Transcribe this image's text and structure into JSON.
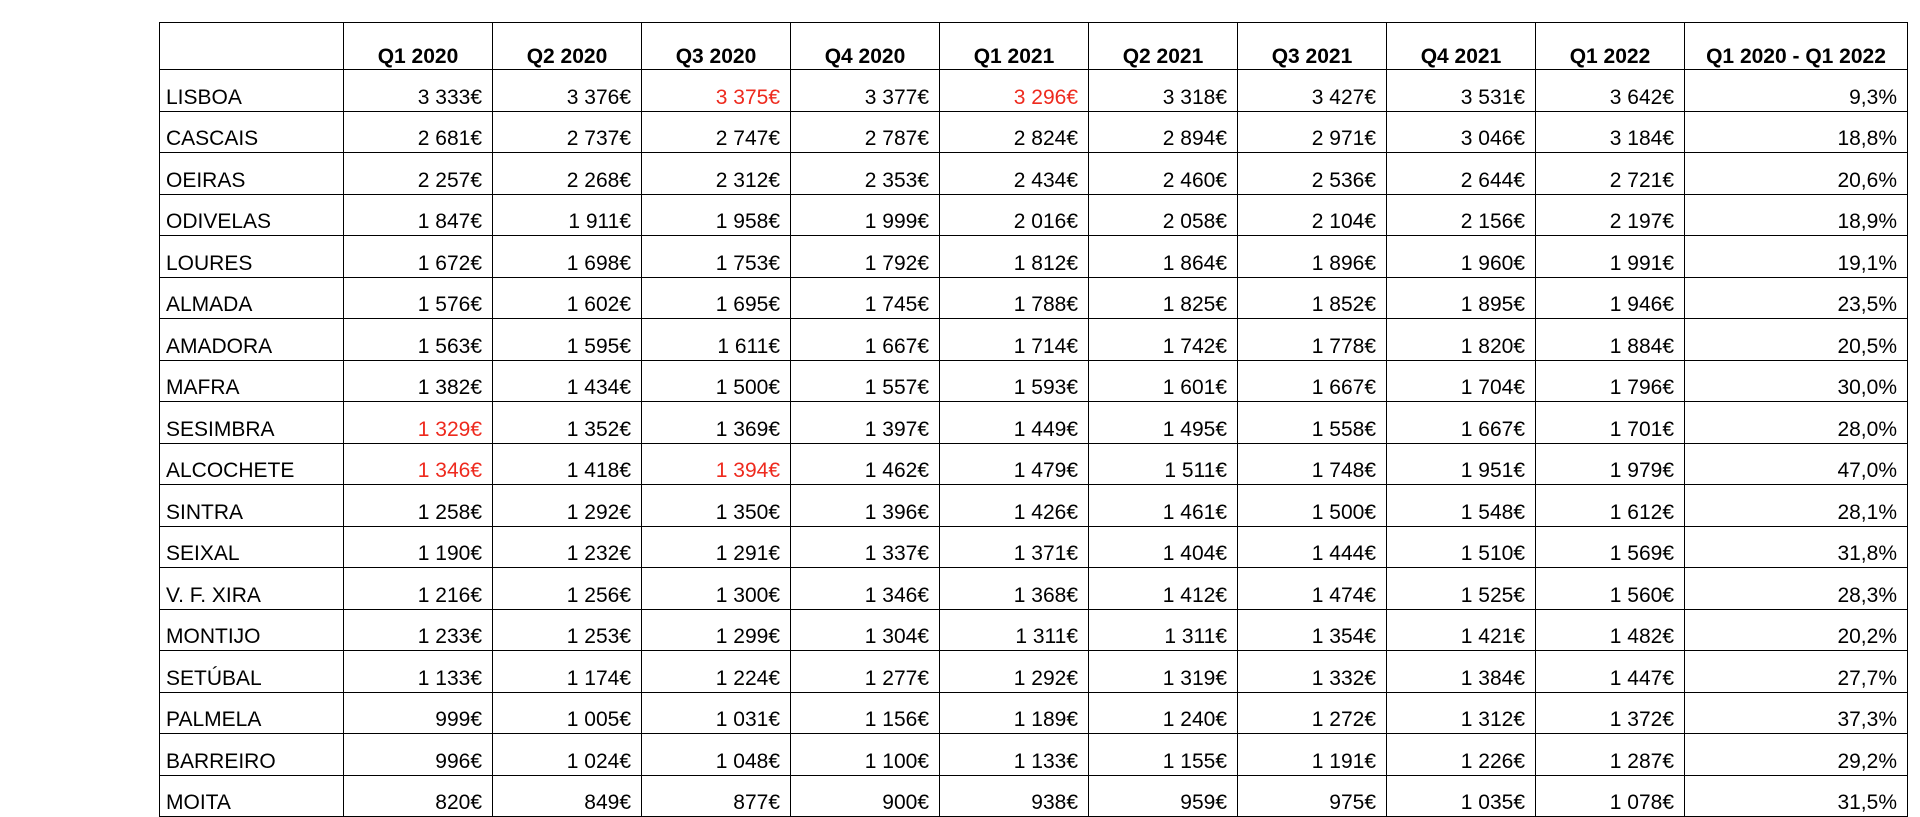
{
  "header": [
    "",
    "Q1 2020",
    "Q2 2020",
    "Q3 2020",
    "Q4 2020",
    "Q1 2021",
    "Q2 2021",
    "Q3 2021",
    "Q4 2021",
    "Q1 2022",
    "Q1 2020 - Q1 2022"
  ],
  "rows": [
    {
      "name": "LISBOA",
      "values": [
        "3 333€",
        "3 376€",
        "3 375€",
        "3 377€",
        "3 296€",
        "3 318€",
        "3 427€",
        "3 531€",
        "3 642€"
      ],
      "change": "9,3%",
      "red": [
        false,
        false,
        true,
        false,
        true,
        false,
        false,
        false,
        false
      ]
    },
    {
      "name": "CASCAIS",
      "values": [
        "2 681€",
        "2 737€",
        "2 747€",
        "2 787€",
        "2 824€",
        "2 894€",
        "2 971€",
        "3 046€",
        "3 184€"
      ],
      "change": "18,8%",
      "red": [
        false,
        false,
        false,
        false,
        false,
        false,
        false,
        false,
        false
      ]
    },
    {
      "name": "OEIRAS",
      "values": [
        "2 257€",
        "2 268€",
        "2 312€",
        "2 353€",
        "2 434€",
        "2 460€",
        "2 536€",
        "2 644€",
        "2 721€"
      ],
      "change": "20,6%",
      "red": [
        false,
        false,
        false,
        false,
        false,
        false,
        false,
        false,
        false
      ]
    },
    {
      "name": "ODIVELAS",
      "values": [
        "1 847€",
        "1 911€",
        "1 958€",
        "1 999€",
        "2 016€",
        "2 058€",
        "2 104€",
        "2 156€",
        "2 197€"
      ],
      "change": "18,9%",
      "red": [
        false,
        false,
        false,
        false,
        false,
        false,
        false,
        false,
        false
      ]
    },
    {
      "name": "LOURES",
      "values": [
        "1 672€",
        "1 698€",
        "1 753€",
        "1 792€",
        "1 812€",
        "1 864€",
        "1 896€",
        "1 960€",
        "1 991€"
      ],
      "change": "19,1%",
      "red": [
        false,
        false,
        false,
        false,
        false,
        false,
        false,
        false,
        false
      ]
    },
    {
      "name": "ALMADA",
      "values": [
        "1 576€",
        "1 602€",
        "1 695€",
        "1 745€",
        "1 788€",
        "1 825€",
        "1 852€",
        "1 895€",
        "1 946€"
      ],
      "change": "23,5%",
      "red": [
        false,
        false,
        false,
        false,
        false,
        false,
        false,
        false,
        false
      ]
    },
    {
      "name": "AMADORA",
      "values": [
        "1 563€",
        "1 595€",
        "1 611€",
        "1 667€",
        "1 714€",
        "1 742€",
        "1 778€",
        "1 820€",
        "1 884€"
      ],
      "change": "20,5%",
      "red": [
        false,
        false,
        false,
        false,
        false,
        false,
        false,
        false,
        false
      ]
    },
    {
      "name": "MAFRA",
      "values": [
        "1 382€",
        "1 434€",
        "1 500€",
        "1 557€",
        "1 593€",
        "1 601€",
        "1 667€",
        "1 704€",
        "1 796€"
      ],
      "change": "30,0%",
      "red": [
        false,
        false,
        false,
        false,
        false,
        false,
        false,
        false,
        false
      ]
    },
    {
      "name": "SESIMBRA",
      "values": [
        "1 329€",
        "1 352€",
        "1 369€",
        "1 397€",
        "1 449€",
        "1 495€",
        "1 558€",
        "1 667€",
        "1 701€"
      ],
      "change": "28,0%",
      "red": [
        true,
        false,
        false,
        false,
        false,
        false,
        false,
        false,
        false
      ]
    },
    {
      "name": "ALCOCHETE",
      "values": [
        "1 346€",
        "1 418€",
        "1 394€",
        "1 462€",
        "1 479€",
        "1 511€",
        "1 748€",
        "1 951€",
        "1 979€"
      ],
      "change": "47,0%",
      "red": [
        true,
        false,
        true,
        false,
        false,
        false,
        false,
        false,
        false
      ]
    },
    {
      "name": "SINTRA",
      "values": [
        "1 258€",
        "1 292€",
        "1 350€",
        "1 396€",
        "1 426€",
        "1 461€",
        "1 500€",
        "1 548€",
        "1 612€"
      ],
      "change": "28,1%",
      "red": [
        false,
        false,
        false,
        false,
        false,
        false,
        false,
        false,
        false
      ]
    },
    {
      "name": "SEIXAL",
      "values": [
        "1 190€",
        "1 232€",
        "1 291€",
        "1 337€",
        "1 371€",
        "1 404€",
        "1 444€",
        "1 510€",
        "1 569€"
      ],
      "change": "31,8%",
      "red": [
        false,
        false,
        false,
        false,
        false,
        false,
        false,
        false,
        false
      ]
    },
    {
      "name": "V. F. XIRA",
      "values": [
        "1 216€",
        "1 256€",
        "1 300€",
        "1 346€",
        "1 368€",
        "1 412€",
        "1 474€",
        "1 525€",
        "1 560€"
      ],
      "change": "28,3%",
      "red": [
        false,
        false,
        false,
        false,
        false,
        false,
        false,
        false,
        false
      ]
    },
    {
      "name": "MONTIJO",
      "values": [
        "1 233€",
        "1 253€",
        "1 299€",
        "1 304€",
        "1 311€",
        "1 311€",
        "1 354€",
        "1 421€",
        "1 482€"
      ],
      "change": "20,2%",
      "red": [
        false,
        false,
        false,
        false,
        false,
        false,
        false,
        false,
        false
      ]
    },
    {
      "name": "SETÚBAL",
      "values": [
        "1 133€",
        "1 174€",
        "1 224€",
        "1 277€",
        "1 292€",
        "1 319€",
        "1 332€",
        "1 384€",
        "1 447€"
      ],
      "change": "27,7%",
      "red": [
        false,
        false,
        false,
        false,
        false,
        false,
        false,
        false,
        false
      ]
    },
    {
      "name": "PALMELA",
      "values": [
        "999€",
        "1 005€",
        "1 031€",
        "1 156€",
        "1 189€",
        "1 240€",
        "1 272€",
        "1 312€",
        "1 372€"
      ],
      "change": "37,3%",
      "red": [
        false,
        false,
        false,
        false,
        false,
        false,
        false,
        false,
        false
      ]
    },
    {
      "name": "BARREIRO",
      "values": [
        "996€",
        "1 024€",
        "1 048€",
        "1 100€",
        "1 133€",
        "1 155€",
        "1 191€",
        "1 226€",
        "1 287€"
      ],
      "change": "29,2%",
      "red": [
        false,
        false,
        false,
        false,
        false,
        false,
        false,
        false,
        false
      ]
    },
    {
      "name": "MOITA",
      "values": [
        "820€",
        "849€",
        "877€",
        "900€",
        "938€",
        "959€",
        "975€",
        "1 035€",
        "1 078€"
      ],
      "change": "31,5%",
      "red": [
        false,
        false,
        false,
        false,
        false,
        false,
        false,
        false,
        false
      ]
    }
  ],
  "colors": {
    "highlight": "#ee2a1e",
    "text": "#000000",
    "border": "#000000",
    "background": "#ffffff"
  }
}
